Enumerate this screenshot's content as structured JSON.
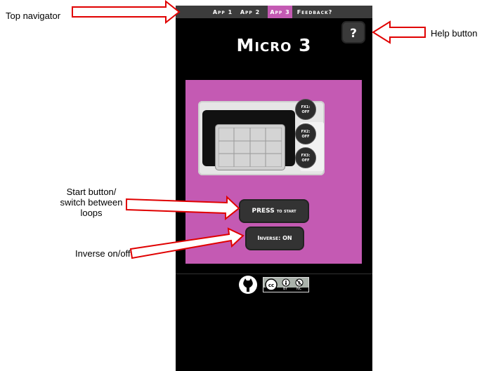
{
  "annotations": {
    "top_navigator": "Top navigator",
    "help_button": "Help button",
    "start_button": [
      "Start button/",
      "switch between",
      "loops"
    ],
    "inverse": "Inverse on/off"
  },
  "nav": {
    "items": [
      {
        "label": "App 1",
        "active": false
      },
      {
        "label": "App 2",
        "active": false
      },
      {
        "label": "App 3",
        "active": true
      },
      {
        "label": "Feedback?",
        "active": false
      }
    ]
  },
  "help_label": "?",
  "title": "Micro 3",
  "fx": [
    {
      "name": "FX1:",
      "state": "OFF"
    },
    {
      "name": "FX2:",
      "state": "OFF"
    },
    {
      "name": "FX3:",
      "state": "OFF"
    }
  ],
  "start_button": {
    "main": "PRESS",
    "sub": "to start"
  },
  "inverse_button": "Inverse: ON",
  "license": {
    "by": "BY",
    "nc": "NC"
  },
  "colors": {
    "accent": "#c45ab3",
    "arrow": "#e00000"
  }
}
